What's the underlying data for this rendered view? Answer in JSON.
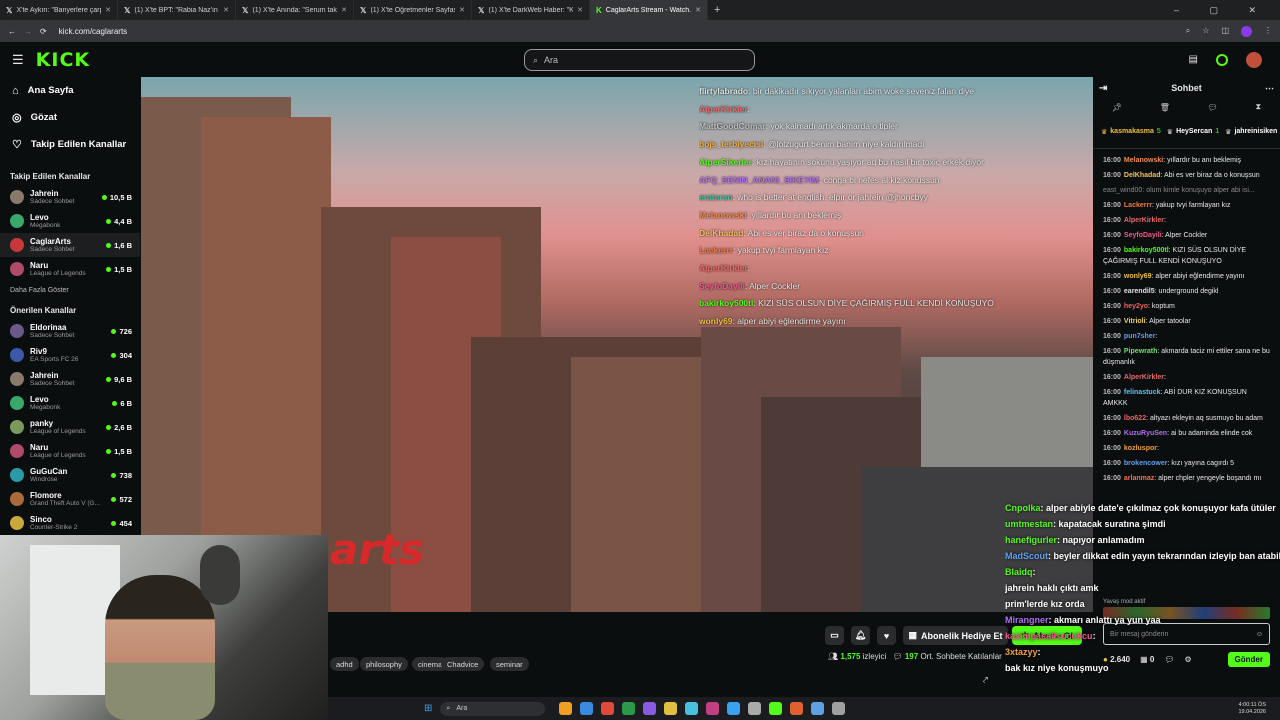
{
  "browser": {
    "tabs": [
      {
        "title": "X'te Aykırı: \"Bariyerlere çarpan ...\"",
        "icon": "x-icon"
      },
      {
        "title": "(1) X'te BPT: \"Rabia Naz'ın baba...\"",
        "icon": "x-icon"
      },
      {
        "title": "(1) X'te Anında: \"Serum takılı ol...\"",
        "icon": "x-icon"
      },
      {
        "title": "(1) X'te Öğretmenler Sayfası \"Ö...\"",
        "icon": "x-icon"
      },
      {
        "title": "(1) X'te DarkWeb Haber: \"Kahra...\"",
        "icon": "x-icon"
      },
      {
        "title": "CaglarArts Stream - Watch...",
        "icon": "kick-icon",
        "active": true
      }
    ],
    "url": "kick.com/caglararts"
  },
  "header": {
    "logo": "KICK",
    "search_placeholder": "Ara"
  },
  "sidebar": {
    "nav": [
      {
        "label": "Ana Sayfa",
        "icon": "home-icon"
      },
      {
        "label": "Gözat",
        "icon": "compass-icon"
      },
      {
        "label": "Takip Edilen Kanallar",
        "icon": "heart-icon"
      }
    ],
    "followed_title": "Takip Edilen Kanallar",
    "followed": [
      {
        "name": "Jahrein",
        "sub": "Sadece Sohbet",
        "viewers": "10,5 B",
        "color": "#8a7a6a"
      },
      {
        "name": "Levo",
        "sub": "Megabonk",
        "viewers": "4,4 B",
        "color": "#3aa86a"
      },
      {
        "name": "CaglarArts",
        "sub": "Sadece Sohbet",
        "viewers": "1,6 B",
        "color": "#c8383a"
      },
      {
        "name": "Naru",
        "sub": "League of Legends",
        "viewers": "1,5 B",
        "color": "#b04a6a"
      }
    ],
    "show_more": "Daha Fazla Göster",
    "recommended_title": "Önerilen Kanallar",
    "recommended": [
      {
        "name": "Eldorinaa",
        "sub": "Sadece Sohbet",
        "viewers": "726",
        "color": "#6a5a8a"
      },
      {
        "name": "Riv9",
        "sub": "EA Sports FC 26",
        "viewers": "304",
        "color": "#3a5aa8"
      },
      {
        "name": "Jahrein",
        "sub": "Sadece Sohbet",
        "viewers": "9,6 B",
        "color": "#8a7a6a"
      },
      {
        "name": "Levo",
        "sub": "Megabonk",
        "viewers": "6 B",
        "color": "#3aa86a"
      },
      {
        "name": "panky",
        "sub": "League of Legends",
        "viewers": "2,6 B",
        "color": "#7a9a5a"
      },
      {
        "name": "Naru",
        "sub": "League of Legends",
        "viewers": "1,5 B",
        "color": "#b04a6a"
      },
      {
        "name": "GuGuCan",
        "sub": "Windrose",
        "viewers": "738",
        "color": "#2a9aa8"
      },
      {
        "name": "Flomore",
        "sub": "Grand Theft Auto V (G...",
        "viewers": "572",
        "color": "#aa6a3a"
      },
      {
        "name": "Sinco",
        "sub": "Counter-Strike 2",
        "viewers": "454",
        "color": "#c8a83a"
      }
    ]
  },
  "stream_overlay_chat": [
    {
      "user": "flirtylabrado",
      "color": "#e0e0e0",
      "text": ": bir dakikadır sıkıyor yalanları abim woke seveniz falan diye"
    },
    {
      "user": "AlperKirkler",
      "color": "#e86a6a",
      "text": ":"
    },
    {
      "user": "MattGoodComar",
      "color": "#c0c0c0",
      "text": ": yok kalmadı artık akmarda o tipler"
    },
    {
      "user": "bojs_terbiyecisi",
      "color": "#f0b040",
      "text": ": @lolzugurt benim banım niye kaldırılmadı"
    },
    {
      "user": "AlperSikerler",
      "color": "#53fc18",
      "text": ": kız hayatının şokunu yaşıyor aq bu nasıl bir toxic erkek diyor"
    },
    {
      "user": "AFQ_SENIN_ANANI_SIKEYIM",
      "color": "#b070f0",
      "text": ": conga bi nefes al kiz konussun"
    },
    {
      "user": "eratersn",
      "color": "#40c0a0",
      "text": ": who is better at english. elpır or jahrein @jhoncbyy"
    },
    {
      "user": "Melanowski",
      "color": "#f08a50",
      "text": ": yıllardır bu anı beklemiş"
    },
    {
      "user": "DelKhadad",
      "color": "#f0c060",
      "text": ": Abi es ver biraz da o konuşsun"
    },
    {
      "user": "Lackerrr",
      "color": "#f07a40",
      "text": ": yakup tvyi farmlayan kız"
    },
    {
      "user": "AlperKirkler",
      "color": "#e86a6a",
      "text": ":"
    },
    {
      "user": "SeyfoDayili",
      "color": "#f05a8a",
      "text": ": Alper Cockler"
    },
    {
      "user": "bakirkoy500tl",
      "color": "#53fc18",
      "text": ": KIZI SÜS OLSUN DİYE ÇAĞIRMIŞ FULL KENDİ KONUŞUYO"
    },
    {
      "user": "wonly69",
      "color": "#f0c040",
      "text": ": alper abiyi eğlendirme yayını"
    }
  ],
  "below_video": {
    "tags": [
      "adhd",
      "philosophy",
      "cinema",
      "Chadvice",
      "seminar"
    ],
    "gift_label": "Abonelik Hediye Et",
    "subscribe_label": "Abone Ol",
    "viewers": "1,575",
    "viewers_label": "izleyici",
    "chat_count": "197",
    "chat_count_label": "Ort. Sohbete Katılanlar"
  },
  "chat": {
    "title": "Sohbet",
    "pinned": [
      {
        "user": "kasmakasma",
        "count": "5"
      },
      {
        "user": "HeySercan",
        "count": "1"
      },
      {
        "user": "jahreinisiken",
        "count": "1"
      }
    ],
    "messages": [
      {
        "time": "16:00",
        "user": "Melanowski",
        "color": "#f08a50",
        "text": ": yıllardır bu anı beklemiş"
      },
      {
        "time": "16:00",
        "user": "DelKhadad",
        "color": "#f0c060",
        "text": ": Abi es ver biraz da o konuşsun"
      },
      {
        "time": "",
        "user": "",
        "color": "#888888",
        "text": "east_wind00: olum kimle konuşuyo alper abi isi..."
      },
      {
        "time": "16:00",
        "user": "Lackerrr",
        "color": "#f07a40",
        "text": ": yakup tvyi farmlayan kız"
      },
      {
        "time": "16:00",
        "user": "AlperKirkler",
        "color": "#e86a6a",
        "text": ":"
      },
      {
        "time": "16:00",
        "user": "SeyfoDayili",
        "color": "#f05a8a",
        "text": ": Alper Cockler"
      },
      {
        "time": "16:00",
        "user": "bakirkoy500tl",
        "color": "#53fc18",
        "text": ": KIZI SÜS OLSUN DİYE ÇAĞIRMIŞ FULL KENDİ KONUŞUYO"
      },
      {
        "time": "16:00",
        "user": "wonly69",
        "color": "#f0c040",
        "text": ": alper abiyi eğlendirme yayını"
      },
      {
        "time": "16:00",
        "user": "earendil5",
        "color": "#e0e0e0",
        "text": ": underground degikl"
      },
      {
        "time": "16:00",
        "user": "hey2yo",
        "color": "#f06060",
        "text": ": koptum"
      },
      {
        "time": "16:00",
        "user": "Vitrioli",
        "color": "#f0d060",
        "text": ": Alper tatoolar"
      },
      {
        "time": "16:00",
        "user": "pun7sher",
        "color": "#60a0f0",
        "text": ":"
      },
      {
        "time": "16:00",
        "user": "Pipewrath",
        "color": "#70e070",
        "text": ": akmarda taciz mi ettiler sana ne bu düşmanlık"
      },
      {
        "time": "16:00",
        "user": "AlperKirkler",
        "color": "#e86a6a",
        "text": ":"
      },
      {
        "time": "16:00",
        "user": "felinastuck",
        "color": "#60c0f0",
        "text": ": ABİ DUR KIZ KONUŞSUN AMKKK"
      },
      {
        "time": "16:00",
        "user": "lbo622",
        "color": "#f06060",
        "text": ": altyazı ekleyin aq susmuyo bu adam"
      },
      {
        "time": "16:00",
        "user": "KuzuRyuSen",
        "color": "#b070f0",
        "text": ": ai bu adaminda elinde cok"
      },
      {
        "time": "16:00",
        "user": "kozluspor",
        "color": "#f0a040",
        "text": ":"
      },
      {
        "time": "16:00",
        "user": "brokencower",
        "color": "#60a0f0",
        "text": ": kızı yayına cagırdı 5"
      },
      {
        "time": "16:00",
        "user": "arlanmaz",
        "color": "#f07050",
        "text": ": alper chpler yengeyle boşandı mı"
      }
    ],
    "slow_mode": "Yavaş mod aktif",
    "input_placeholder": "Bir mesaj gönderin",
    "points": "2.640",
    "count2": "0",
    "send_label": "Gönder"
  },
  "overlay_bottom_chat": [
    {
      "user": "Cnpolka",
      "color": "#53fc18",
      "text": ": alper abiyle date'e çıkılmaz çok konuşuyor kafa ütüler"
    },
    {
      "user": "umtmestan",
      "color": "#53fc18",
      "text": ": kapatacak suratına şimdi"
    },
    {
      "user": "hanefigurler",
      "color": "#53fc18",
      "text": ": napıyor anlamadım"
    },
    {
      "user": "MadScout",
      "color": "#60a0f0",
      "text": ": beyler dikkat edin yayın tekrarından izleyip ban atabilir caglar"
    },
    {
      "user": "Blaidq",
      "color": "#53fc18",
      "text": ":"
    },
    {
      "user": "jahrein haklı çıktı amk",
      "color": "#ffffff",
      "text": ""
    },
    {
      "user": "prim'lerde kız orda",
      "color": "#ffffff",
      "text": ""
    },
    {
      "user": "Mirangner",
      "color": "#b070f0",
      "text": ": akmarı anlattı ya yun yaa"
    },
    {
      "user": "kasimpasalisucukcu",
      "color": "#f05a8a",
      "text": ":"
    },
    {
      "user": "3xtazyy",
      "color": "#f0a040",
      "text": ":"
    },
    {
      "user": "",
      "color": "#ffffff",
      "text": "bak kız niye konuşmuyo"
    }
  ],
  "taskbar": {
    "search": "Ara",
    "time": "4:00:11 ÖS",
    "date": "19.04.2026"
  },
  "colors": {
    "accent": "#53fc18",
    "bg": "#0b0e0f"
  }
}
